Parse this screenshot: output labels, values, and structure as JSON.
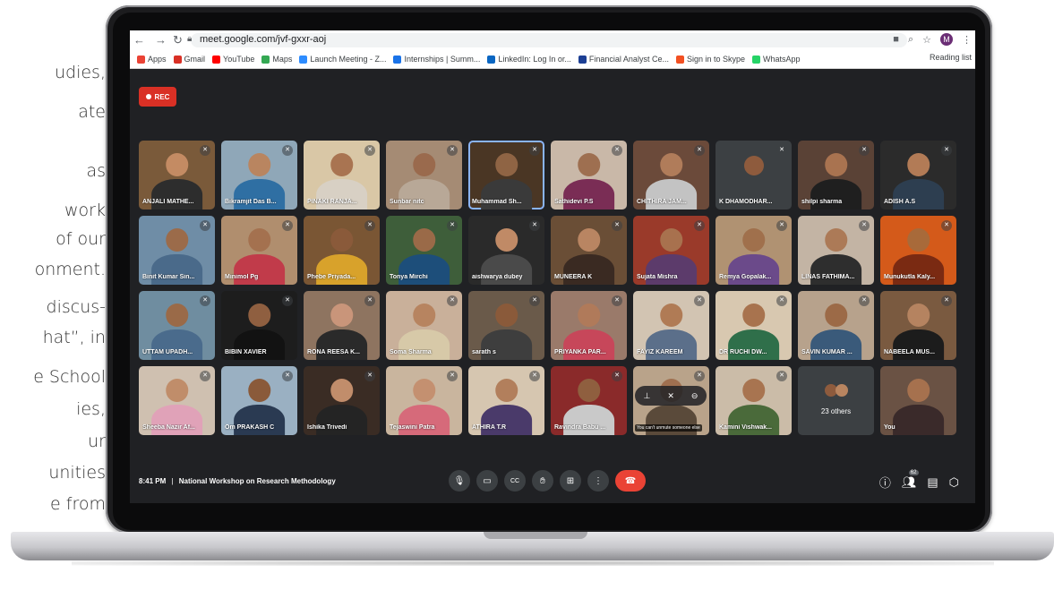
{
  "side_text": [
    "udies,",
    "ate",
    "as",
    "work",
    "of our",
    "onment.",
    "discus-",
    "hat”, in",
    "e School",
    "ies,",
    "ur",
    "unities",
    "e from"
  ],
  "browser": {
    "url": "meet.google.com/jvf-gxxr-aoj",
    "profile_initial": "M",
    "bookmarks": [
      {
        "label": "Apps",
        "color": "#ea4335"
      },
      {
        "label": "Gmail",
        "color": "#d93025"
      },
      {
        "label": "YouTube",
        "color": "#ff0000"
      },
      {
        "label": "Maps",
        "color": "#34a853"
      },
      {
        "label": "Launch Meeting - Z...",
        "color": "#2d8cff"
      },
      {
        "label": "Internships | Summ...",
        "color": "#1a73e8"
      },
      {
        "label": "LinkedIn: Log In or...",
        "color": "#0a66c2"
      },
      {
        "label": "Financial Analyst Ce...",
        "color": "#1c3f94"
      },
      {
        "label": "Sign in to Skype",
        "color": "#f25022"
      },
      {
        "label": "WhatsApp",
        "color": "#25d366"
      }
    ],
    "reading_list": "Reading list"
  },
  "meet": {
    "rec_label": "REC",
    "time": "8:41 PM",
    "separator": "|",
    "meeting_title": "National Workshop on Research Methodology",
    "people_count": "62",
    "others_label": "23 others",
    "tooltip": "You can't unmute someone else",
    "participants": [
      {
        "name": "ANJALI MATHE...",
        "bg": "#7a5a3a",
        "skin": "#c48b63",
        "shirt": "#2d2d2d"
      },
      {
        "name": "Bikramjit Das B...",
        "bg": "#8fa7b8",
        "skin": "#b98560",
        "shirt": "#2f6fa3"
      },
      {
        "name": "PINAKI RANJA...",
        "bg": "#d9c7a6",
        "skin": "#a97451",
        "shirt": "#d8d0c4"
      },
      {
        "name": "Sunbar nitc",
        "bg": "#a58b74",
        "skin": "#9a6a4d",
        "shirt": "#b8a897"
      },
      {
        "name": "Muhammad Sh...",
        "bg": "#4a3624",
        "skin": "#8f6444",
        "shirt": "#3a3a3a"
      },
      {
        "name": "Sathidevi P.S",
        "bg": "#c9b8a8",
        "skin": "#9e6f50",
        "shirt": "#7a2d55"
      },
      {
        "name": "CHITHIRA JAM...",
        "bg": "#6b4a3a",
        "skin": "#b07c5a",
        "shirt": "#c3c3c3"
      },
      {
        "name": "K DHAMODHAR...",
        "bg": "#3c4043",
        "skin": "#8e5b3d",
        "shirt": "#3c4043"
      },
      {
        "name": "shilpi sharma",
        "bg": "#5a4236",
        "skin": "#a97350",
        "shirt": "#1f1f1f"
      },
      {
        "name": "ADISH A.S",
        "bg": "#2b2b2b",
        "skin": "#b27b56",
        "shirt": "#2d3e50"
      },
      {
        "name": "Binit Kumar Sin...",
        "bg": "#6f8da6",
        "skin": "#9b6b4a",
        "shirt": "#4a6a8a"
      },
      {
        "name": "Minimol Pg",
        "bg": "#b08e6e",
        "skin": "#a4714f",
        "shirt": "#c13b4a"
      },
      {
        "name": "Phebe Priyada...",
        "bg": "#7a5634",
        "skin": "#8a5a3a",
        "shirt": "#d8a22b"
      },
      {
        "name": "Tonya Mirchi",
        "bg": "#3e5e3a",
        "skin": "#9a6a48",
        "shirt": "#1d4e7a"
      },
      {
        "name": "aishwarya dubey",
        "bg": "#2a2a2a",
        "skin": "#c08a66",
        "shirt": "#4a4a4a"
      },
      {
        "name": "MUNEERA K",
        "bg": "#6a4e36",
        "skin": "#b98562",
        "shirt": "#3a2a22"
      },
      {
        "name": "Sujata Mishra",
        "bg": "#9a3a2a",
        "skin": "#a8714e",
        "shirt": "#5c3b6b"
      },
      {
        "name": "Remya Gopalak...",
        "bg": "#b09272",
        "skin": "#a0704c",
        "shirt": "#6b4a8a"
      },
      {
        "name": "LINAS FATHIMA...",
        "bg": "#c3b4a4",
        "skin": "#ac7a57",
        "shirt": "#2e2e2e"
      },
      {
        "name": "Munukutla Kaly...",
        "bg": "#d45a1a",
        "skin": "#a86a3a",
        "shirt": "#7a2a12"
      },
      {
        "name": "UTTAM UPADH...",
        "bg": "#6f8da0",
        "skin": "#9a6a48",
        "shirt": "#4a6b8c"
      },
      {
        "name": "BIBIN XAVIER",
        "bg": "#1d1d1d",
        "skin": "#8f5f40",
        "shirt": "#121212"
      },
      {
        "name": "RONA REESA K...",
        "bg": "#8e7460",
        "skin": "#c9957a",
        "shirt": "#2a2a2a"
      },
      {
        "name": "Soma Sharma",
        "bg": "#c9b09a",
        "skin": "#b78460",
        "shirt": "#d7c9a8"
      },
      {
        "name": "sarath s",
        "bg": "#6a5a4a",
        "skin": "#8a5a3a",
        "shirt": "#3e3e3e"
      },
      {
        "name": "PRIYANKA PAR...",
        "bg": "#9a7a6a",
        "skin": "#b07a5a",
        "shirt": "#c7475a"
      },
      {
        "name": "FAYIZ KAREEM",
        "bg": "#d2c4b2",
        "skin": "#b07b55",
        "shirt": "#5b6f8a"
      },
      {
        "name": "DR RUCHI DW...",
        "bg": "#d8c8b0",
        "skin": "#a8734e",
        "shirt": "#2f6f4a"
      },
      {
        "name": "SAVIN KUMAR ...",
        "bg": "#b7a28c",
        "skin": "#9c6a47",
        "shirt": "#3a5a7a"
      },
      {
        "name": "NABEELA MUS...",
        "bg": "#7a5a40",
        "skin": "#b58360",
        "shirt": "#1c1c1c"
      },
      {
        "name": "Sheeba Nazir Af...",
        "bg": "#cfc0b0",
        "skin": "#c08d6a",
        "shirt": "#e0a2b8"
      },
      {
        "name": "Om PRAKASH C",
        "bg": "#9ab0c2",
        "skin": "#8a5a3a",
        "shirt": "#2a3a52"
      },
      {
        "name": "Ishika Trivedi",
        "bg": "#3a2c24",
        "skin": "#c18d6b",
        "shirt": "#242424"
      },
      {
        "name": "Tejaswini Patra",
        "bg": "#c9b59e",
        "skin": "#c49070",
        "shirt": "#d66a7a"
      },
      {
        "name": "ATHIRA T.R",
        "bg": "#d6c6b0",
        "skin": "#b27f5c",
        "shirt": "#4a3a6a"
      },
      {
        "name": "Ravindra Babu ...",
        "bg": "#8a2a2a",
        "skin": "#8f5f3f",
        "shirt": "#c9c9c9"
      },
      {
        "name": "",
        "bg": "#b9a38a",
        "skin": "#a07050",
        "shirt": "#5a4a3a"
      },
      {
        "name": "Kamini Vishwak...",
        "bg": "#cbbca8",
        "skin": "#a87450",
        "shirt": "#4a6a3a"
      }
    ],
    "self_label": "You"
  }
}
